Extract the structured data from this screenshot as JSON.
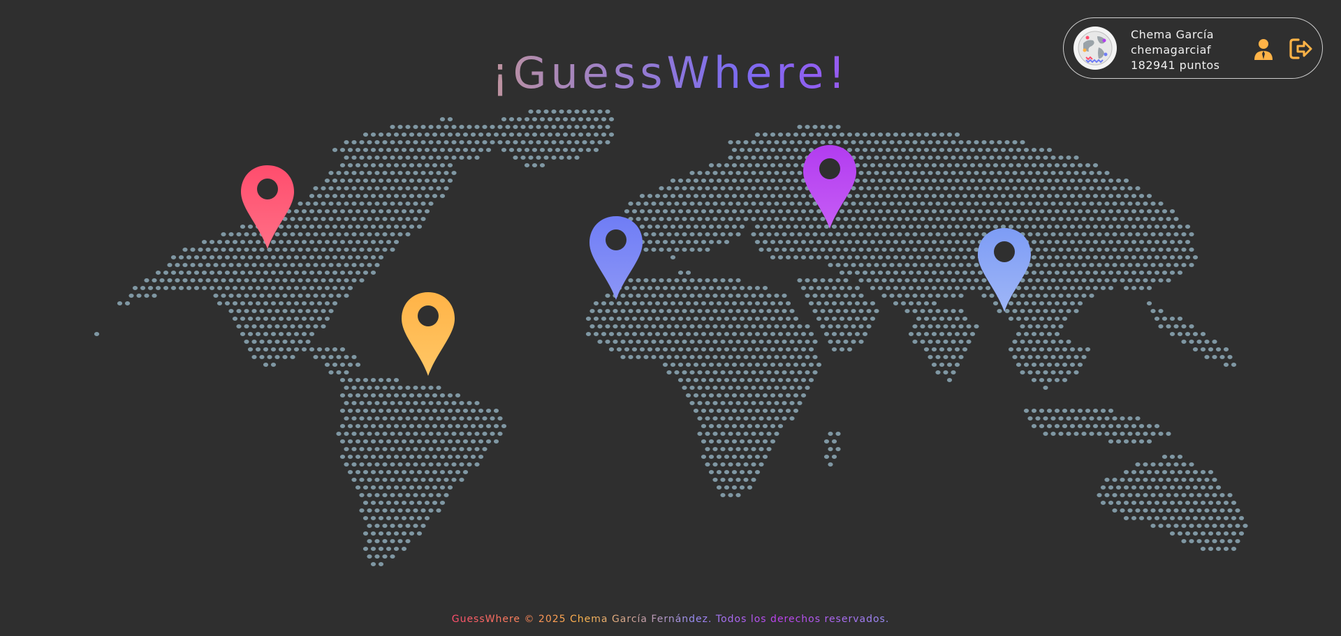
{
  "app": {
    "title": "¡GuessWhere!"
  },
  "user": {
    "name": "Chema García",
    "username": "chemagarciaf",
    "points": "182941 puntos",
    "avatar_icon": "globe-avatar-icon"
  },
  "actions": {
    "profile_icon": "user-icon",
    "logout_icon": "logout-icon"
  },
  "map": {
    "dot_color": "#7f97a3",
    "pins": [
      {
        "name": "pin-north-america",
        "color_top": "#ff4d6d",
        "color_bottom": "#ff6f86"
      },
      {
        "name": "pin-south-america",
        "color_top": "#ffb347",
        "color_bottom": "#ffc766"
      },
      {
        "name": "pin-africa",
        "color_top": "#6f7df5",
        "color_bottom": "#8c96f7"
      },
      {
        "name": "pin-asia",
        "color_top": "#b23cf0",
        "color_bottom": "#c65df5"
      },
      {
        "name": "pin-southeast-asia",
        "color_top": "#7d9cf5",
        "color_bottom": "#9fb6f7"
      }
    ]
  },
  "footer": {
    "text": "GuessWhere © 2025 Chema García Fernández. Todos los derechos reservados."
  },
  "colors": {
    "background": "#2f2f2f",
    "accent_orange": "#ffb347"
  }
}
